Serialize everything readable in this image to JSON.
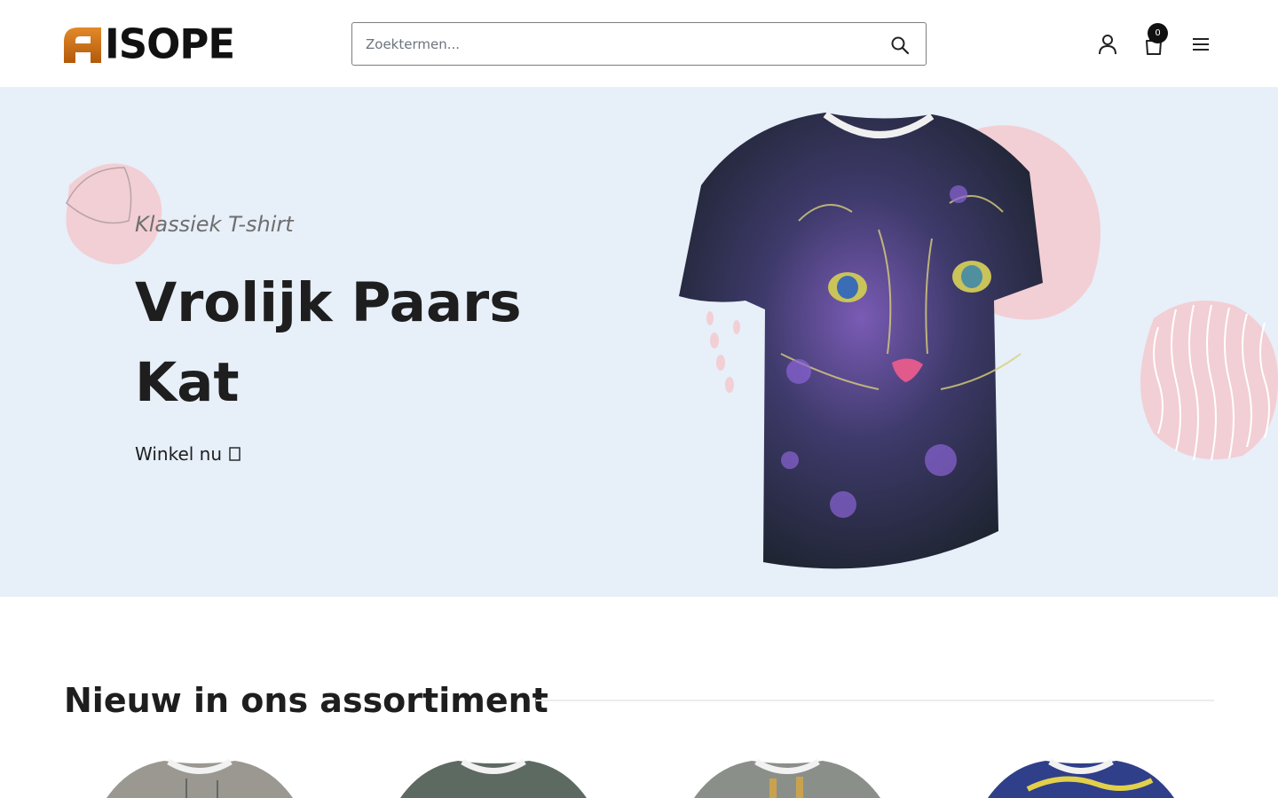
{
  "brand": {
    "logo_text": "AISOPE",
    "accent_color": "#c8690f"
  },
  "search": {
    "placeholder": "Zoektermen...",
    "icon": "search-icon"
  },
  "header_icons": {
    "account": "user-icon",
    "cart": "shopping-bag-icon",
    "cart_count": "0",
    "menu": "menu-icon"
  },
  "hero": {
    "subtitle": "Klassiek T-shirt",
    "title": "Vrolijk Paars Kat",
    "cta_label": "Winkel nu",
    "cta_icon": "arrow-right-icon",
    "background": "#e7eff9"
  },
  "section": {
    "title": "Nieuw in ons assortiment"
  },
  "products": [
    {
      "name": "product-1"
    },
    {
      "name": "product-2"
    },
    {
      "name": "product-3"
    },
    {
      "name": "product-4"
    }
  ]
}
